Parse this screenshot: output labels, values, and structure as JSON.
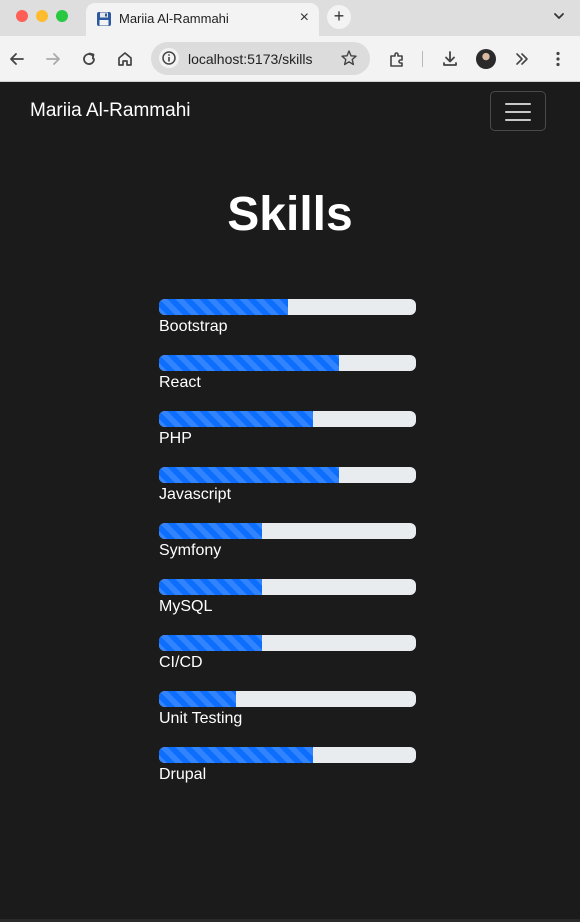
{
  "browser": {
    "tab_title": "Mariia Al-Rammahi",
    "tab_close": "×",
    "new_tab": "+",
    "url": "localhost:5173/skills"
  },
  "navbar": {
    "brand": "Mariia Al-Rammahi"
  },
  "page": {
    "title": "Skills"
  },
  "skills": [
    {
      "label": "Bootstrap",
      "progress": 0.5
    },
    {
      "label": "React",
      "progress": 0.7
    },
    {
      "label": "PHP",
      "progress": 0.6
    },
    {
      "label": "Javascript",
      "progress": 0.7
    },
    {
      "label": "Symfony",
      "progress": 0.4
    },
    {
      "label": "MySQL",
      "progress": 0.4
    },
    {
      "label": "CI/CD",
      "progress": 0.4
    },
    {
      "label": "Unit Testing",
      "progress": 0.3
    },
    {
      "label": "Drupal",
      "progress": 0.6
    }
  ],
  "colors": {
    "background": "#1b1b1c",
    "progress_fill": "#0d6efd",
    "progress_track": "#e9ecef",
    "text": "#ffffff"
  }
}
